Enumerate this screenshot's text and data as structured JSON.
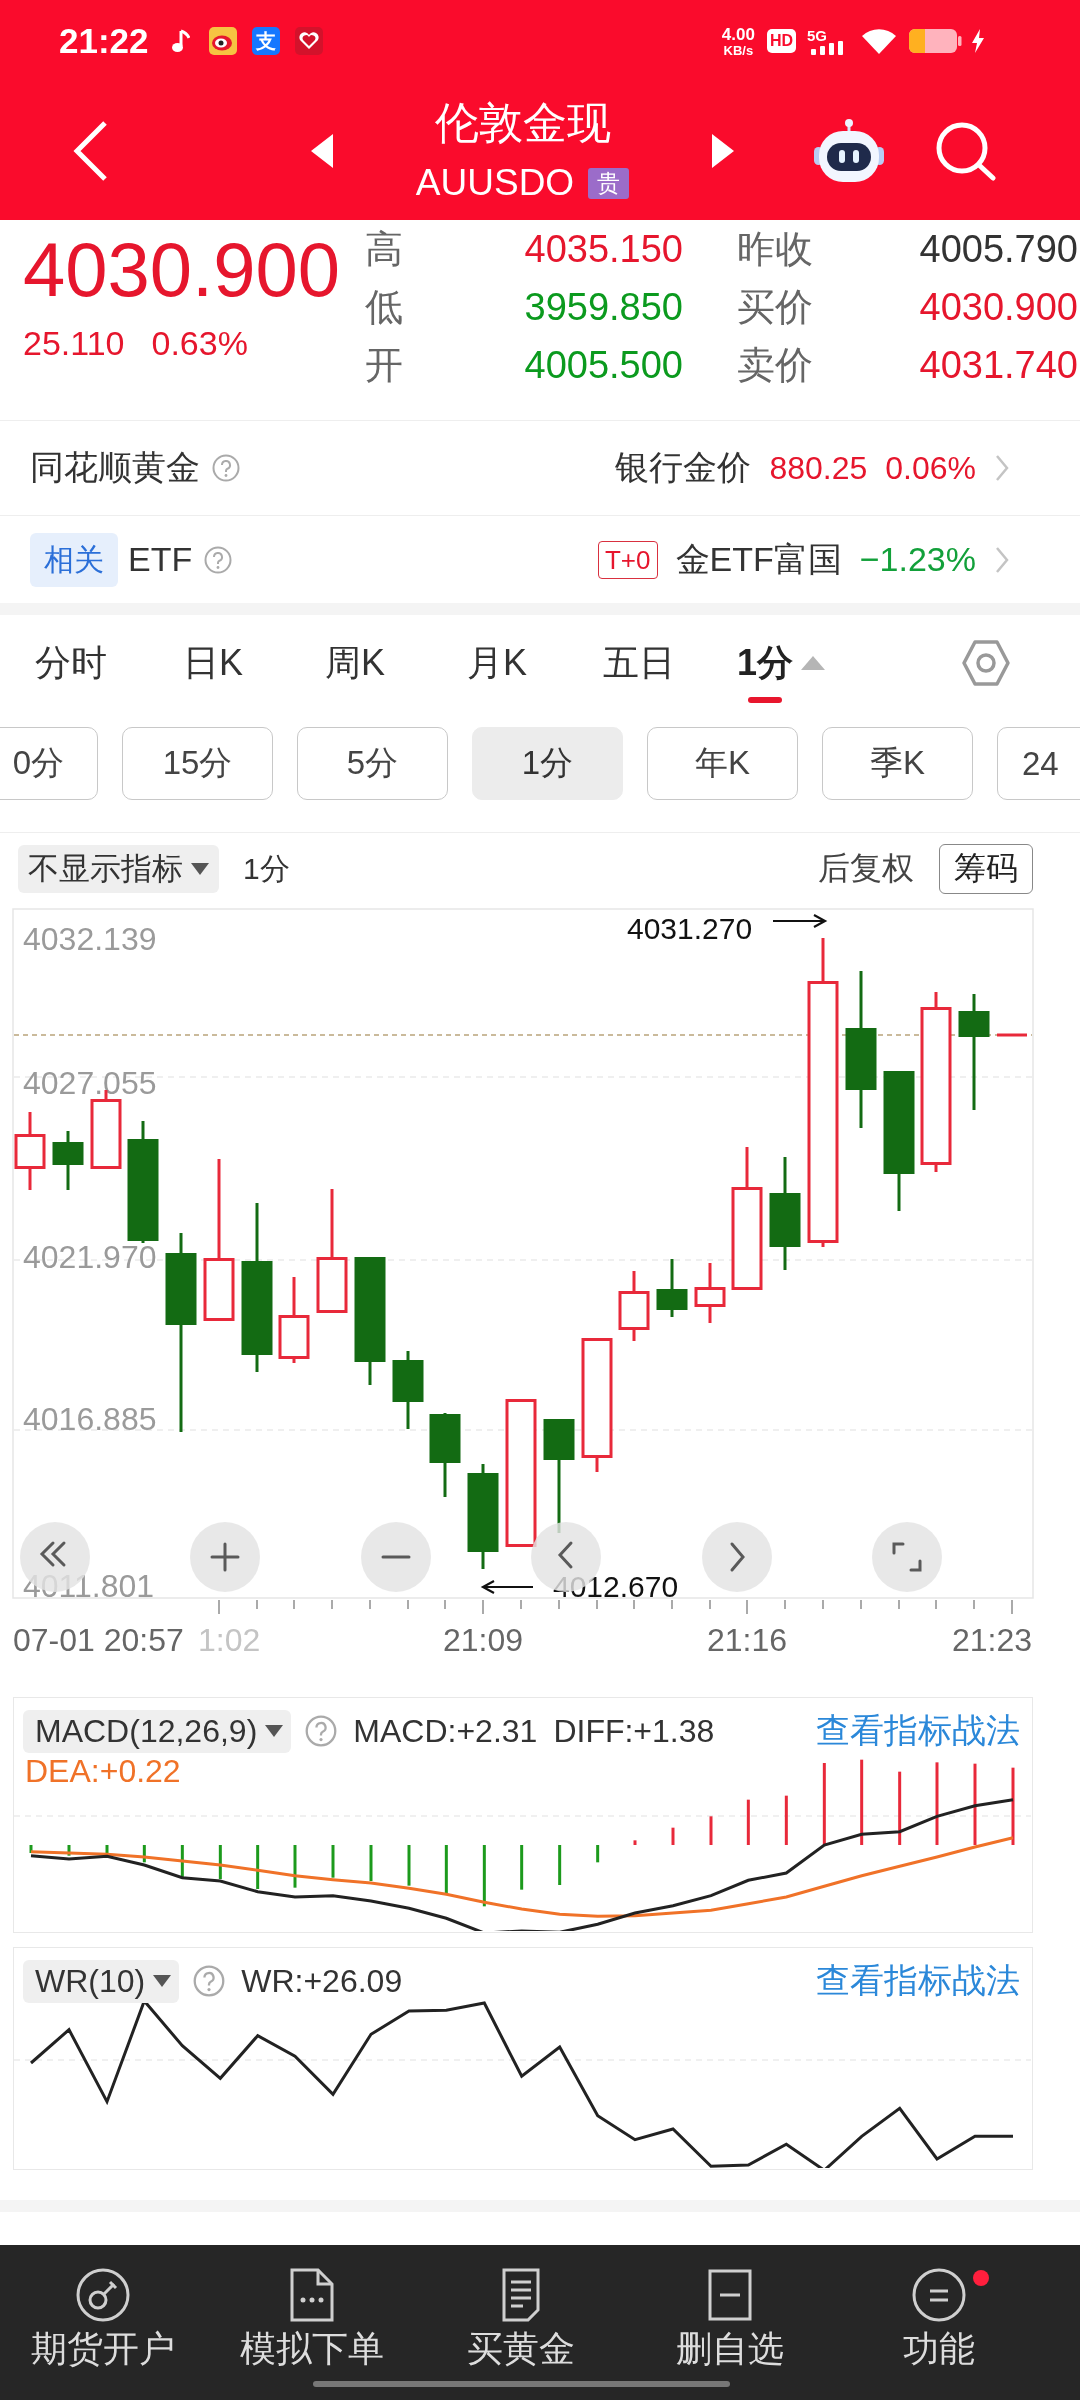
{
  "status_bar": {
    "time": "21:22",
    "app_badge": "支",
    "net_speed": "4.00",
    "net_unit": "KB/s",
    "hd": "HD",
    "network": "5G"
  },
  "header": {
    "title": "伦敦金现",
    "symbol": "AUUSDO",
    "tag": "贵"
  },
  "quote": {
    "price": "4030.900",
    "change": "25.110",
    "change_percent": "0.63%",
    "stats": [
      {
        "label": "高",
        "value": "4035.150",
        "color": "#e6162d"
      },
      {
        "label": "昨收",
        "value": "4005.790",
        "color": "#333333"
      },
      {
        "label": "低",
        "value": "3959.850",
        "color": "#0b9a1e"
      },
      {
        "label": "买价",
        "value": "4030.900",
        "color": "#e6162d"
      },
      {
        "label": "开",
        "value": "4005.500",
        "color": "#0b9a1e"
      },
      {
        "label": "卖价",
        "value": "4031.740",
        "color": "#e6162d"
      }
    ]
  },
  "gold_row": {
    "title": "同花顺黄金",
    "label": "银行金价",
    "price": "880.25",
    "change": "0.06%"
  },
  "etf_row": {
    "tag": "相关",
    "title": "ETF",
    "badge": "T+0",
    "name": "金ETF富国",
    "change": "−1.23%"
  },
  "period_tabs": [
    {
      "label": "分时",
      "selected": false,
      "dropdown": false
    },
    {
      "label": "日K",
      "selected": false,
      "dropdown": false
    },
    {
      "label": "周K",
      "selected": false,
      "dropdown": false
    },
    {
      "label": "月K",
      "selected": false,
      "dropdown": false
    },
    {
      "label": "五日",
      "selected": false,
      "dropdown": false
    },
    {
      "label": "1分",
      "selected": true,
      "dropdown": true
    }
  ],
  "interval_chips": [
    {
      "label": "0分",
      "selected": false
    },
    {
      "label": "15分",
      "selected": false
    },
    {
      "label": "5分",
      "selected": false
    },
    {
      "label": "1分",
      "selected": true
    },
    {
      "label": "年K",
      "selected": false
    },
    {
      "label": "季K",
      "selected": false
    },
    {
      "label": "24",
      "selected": false
    }
  ],
  "chart_toolbar": {
    "indicator": "不显示指标",
    "period": "1分",
    "adjustment": "后复权",
    "button": "筹码"
  },
  "kline": {
    "y_labels": [
      "4032.139",
      "4027.055",
      "4021.970",
      "4016.885",
      "4011.801"
    ],
    "x_labels": [
      {
        "label": "07-01 20:57",
        "dimmed": false
      },
      {
        "label": "1:02",
        "dimmed": true
      },
      {
        "label": "21:09",
        "dimmed": false
      },
      {
        "label": "21:16",
        "dimmed": false
      },
      {
        "label": "21:23",
        "dimmed": false
      }
    ],
    "high_marker": "4031.270",
    "low_marker": "4012.670"
  },
  "macd": {
    "indicator": "MACD(12,26,9)",
    "macd": "MACD:+2.31",
    "diff": "DIFF:+1.38",
    "dea": "DEA:+0.22",
    "link": "查看指标战法"
  },
  "wr": {
    "indicator": "WR(10)",
    "wr": "WR:+26.09",
    "link": "查看指标战法"
  },
  "bottom_nav": [
    {
      "label": "期货开户",
      "kind": "key",
      "badge": false
    },
    {
      "label": "模拟下单",
      "kind": "order",
      "badge": false
    },
    {
      "label": "买黄金",
      "kind": "document",
      "badge": false
    },
    {
      "label": "删自选",
      "kind": "remove",
      "badge": false
    },
    {
      "label": "功能",
      "kind": "menu",
      "badge": true
    }
  ]
}
